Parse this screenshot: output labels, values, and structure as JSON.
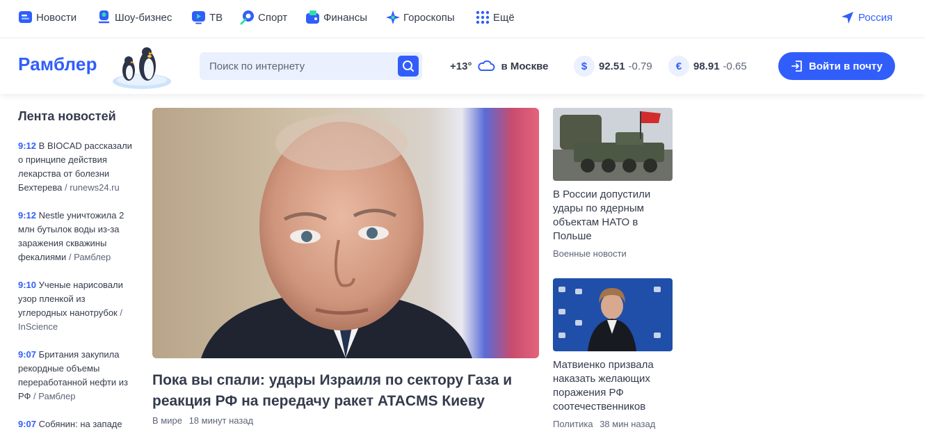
{
  "topnav": {
    "items": [
      {
        "label": "Новости",
        "icon": "news-icon"
      },
      {
        "label": "Шоу-бизнес",
        "icon": "microphone-icon"
      },
      {
        "label": "ТВ",
        "icon": "tv-icon"
      },
      {
        "label": "Спорт",
        "icon": "sport-icon"
      },
      {
        "label": "Финансы",
        "icon": "wallet-icon"
      },
      {
        "label": "Гороскопы",
        "icon": "star-icon"
      },
      {
        "label": "Ещё",
        "icon": "grid-icon"
      }
    ],
    "region": "Россия",
    "colors": {
      "accent": "#315efb",
      "text": "#343b4c",
      "muted": "#5d6578"
    }
  },
  "header": {
    "logo": "Рамблер",
    "search_placeholder": "Поиск по интернету",
    "weather": {
      "temp": "+13°",
      "city": "в Москве"
    },
    "rates": [
      {
        "symbol": "$",
        "value": "92.51",
        "change": "-0.79"
      },
      {
        "symbol": "€",
        "value": "98.91",
        "change": "-0.65"
      }
    ],
    "login_label": "Войти в почту"
  },
  "feed": {
    "title": "Лента новостей",
    "items": [
      {
        "time": "9:12",
        "text": "В BIOCAD рассказали о принципе действия лекарства от болезни Бехтерева",
        "source": "runews24.ru"
      },
      {
        "time": "9:12",
        "text": "Nestle уничтожила 2 млн бутылок воды из-за заражения скважины фекалиями",
        "source": "Рамблер"
      },
      {
        "time": "9:10",
        "text": "Ученые нарисовали узор пленкой из углеродных нанотрубок",
        "source": "InScience"
      },
      {
        "time": "9:07",
        "text": "Британия закупила рекордные объемы переработанной нефти из РФ",
        "source": "Рамблер"
      },
      {
        "time": "9:07",
        "text": "Собянин: на западе",
        "source": ""
      }
    ]
  },
  "main": {
    "title": "Пока вы спали: удары Израиля по сектору Газа и реакция РФ на передачу ракет ATACMS Киеву",
    "category": "В мире",
    "time": "18 минут назад"
  },
  "side": [
    {
      "title": "В России допустили удары по ядерным объектам НАТО в Польше",
      "category": "Военные новости",
      "time": ""
    },
    {
      "title": "Матвиенко призвала наказать желающих поражения РФ соотечественников",
      "category": "Политика",
      "time": "38 мин назад"
    }
  ]
}
